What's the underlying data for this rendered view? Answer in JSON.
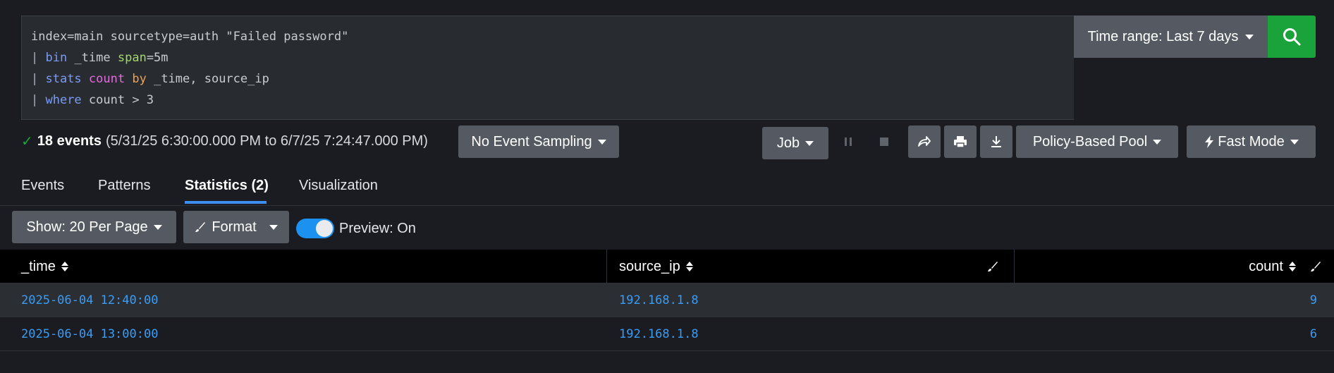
{
  "search": {
    "lines": [
      [
        {
          "t": "index=main sourcetype=auth \"Failed password\"",
          "c": "plain"
        }
      ],
      [
        {
          "t": "| ",
          "c": "pipe"
        },
        {
          "t": "bin",
          "c": "cmd"
        },
        {
          "t": " _time ",
          "c": "plain"
        },
        {
          "t": "span",
          "c": "arg"
        },
        {
          "t": "=5m",
          "c": "plain"
        }
      ],
      [
        {
          "t": "| ",
          "c": "pipe"
        },
        {
          "t": "stats",
          "c": "cmd"
        },
        {
          "t": " ",
          "c": "plain"
        },
        {
          "t": "count",
          "c": "fn"
        },
        {
          "t": " ",
          "c": "plain"
        },
        {
          "t": "by",
          "c": "kw"
        },
        {
          "t": " _time, source_ip",
          "c": "plain"
        }
      ],
      [
        {
          "t": "| ",
          "c": "pipe"
        },
        {
          "t": "where",
          "c": "cmd"
        },
        {
          "t": " count > 3",
          "c": "plain"
        }
      ]
    ],
    "time_range_label": "Time range: Last 7 days",
    "search_icon": "search-icon"
  },
  "status": {
    "count_text": "18 events",
    "range_text": "(5/31/25 6:30:00.000 PM to 6/7/25 7:24:47.000 PM)"
  },
  "controls": {
    "sampling_label": "No Event Sampling",
    "job_label": "Job",
    "pool_label": "Policy-Based Pool",
    "mode_label": "Fast Mode"
  },
  "tabs": {
    "events": "Events",
    "patterns": "Patterns",
    "statistics": "Statistics (2)",
    "visualization": "Visualization",
    "active": "statistics"
  },
  "toolbar": {
    "show_label": "Show: 20 Per Page",
    "format_label": "Format",
    "preview_label": "Preview: On",
    "preview_on": true
  },
  "table": {
    "columns": [
      "_time",
      "source_ip",
      "count"
    ],
    "rows": [
      [
        "2025-06-04 12:40:00",
        "192.168.1.8",
        "9"
      ],
      [
        "2025-06-04 13:00:00",
        "192.168.1.8",
        "6"
      ]
    ]
  },
  "colors": {
    "accent_blue": "#3b8ef0",
    "search_green": "#1aa33b",
    "link_blue": "#3b9cf5"
  }
}
